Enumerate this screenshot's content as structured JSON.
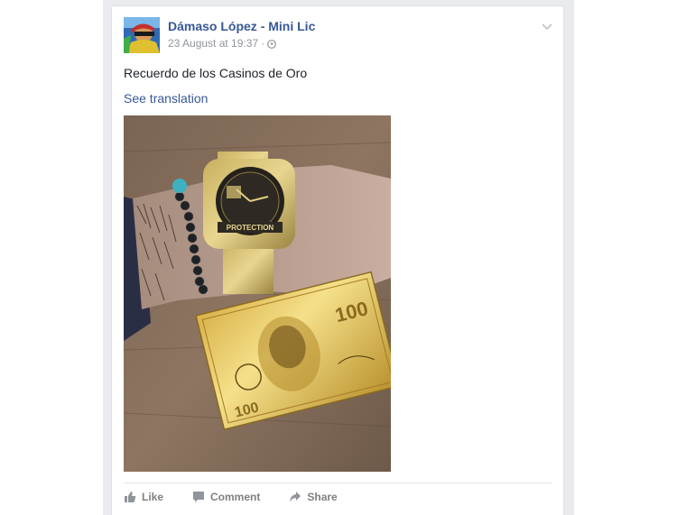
{
  "post": {
    "author_name": "Dámaso López - Mini Lic",
    "timestamp": "23 August at 19:37",
    "separator": "·",
    "privacy_icon": "globe-icon",
    "text": "Recuerdo de los Casinos de Oro",
    "translate_link": "See translation",
    "menu_icon": "chevron-down-icon"
  },
  "photo": {
    "watch_brand_text": "PROTECTION"
  },
  "actions": {
    "like_label": "Like",
    "comment_label": "Comment",
    "share_label": "Share",
    "like_icon": "thumbs-up-icon",
    "comment_icon": "speech-bubble-icon",
    "share_icon": "share-arrow-icon"
  },
  "colors": {
    "link_blue": "#365899",
    "meta_gray": "#90949c",
    "text_dark": "#1d2129",
    "page_background": "#e9ebee"
  }
}
